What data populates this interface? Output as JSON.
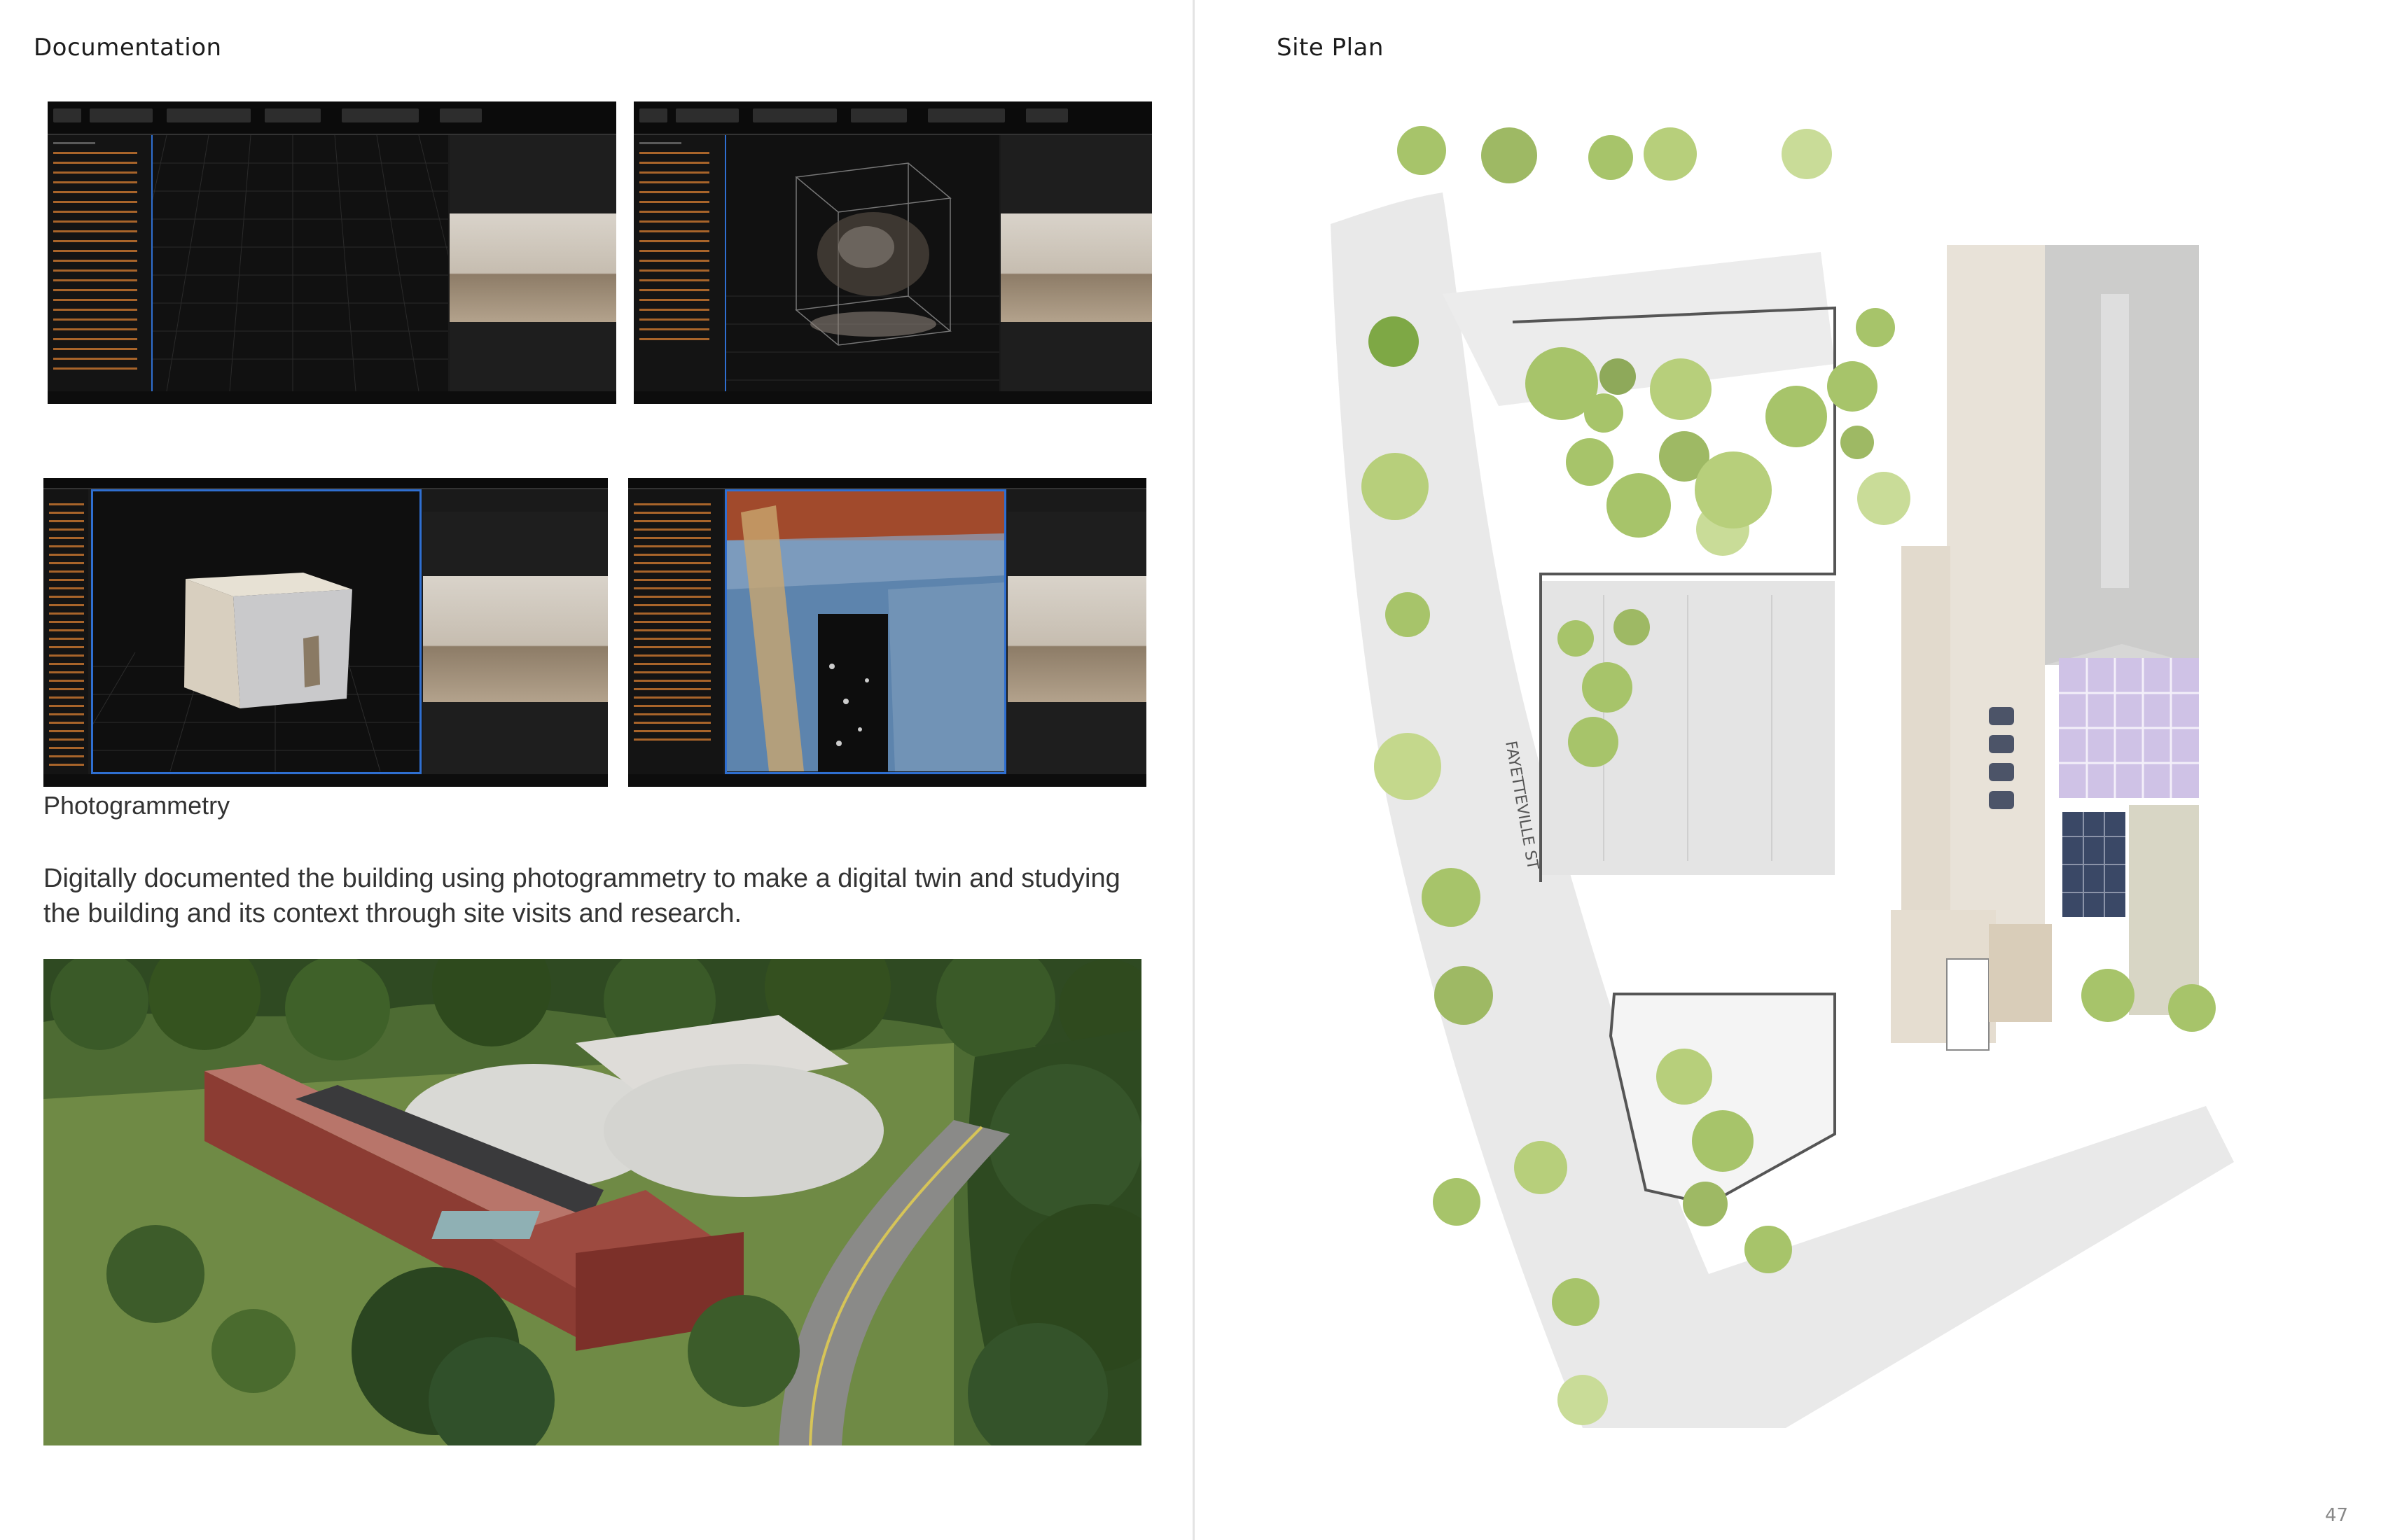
{
  "left_page": {
    "section_title": "Documentation",
    "photogrammetry_caption": "Photogrammetry",
    "description": "Digitally documented the building using photogrammetry to make a digital twin and studying the building and its context through site visits and research.",
    "screenshots": [
      {
        "name": "empty-grid-viewport"
      },
      {
        "name": "point-cloud-viewport"
      },
      {
        "name": "mesh-box-viewport"
      },
      {
        "name": "textured-mesh-viewport"
      }
    ]
  },
  "right_page": {
    "section_title": "Site Plan",
    "street_label": "FAYETTEVILLE ST",
    "page_number": "47"
  },
  "colors": {
    "tree_green": "#a7c46a",
    "road_grey": "#e9e9e9",
    "building_beige": "#e6e0d6",
    "greenhouse_purple": "#cfc2e6",
    "solar_blue": "#3a4866",
    "app_dark": "#1a1a1a",
    "app_accent": "#2f6fd1"
  }
}
